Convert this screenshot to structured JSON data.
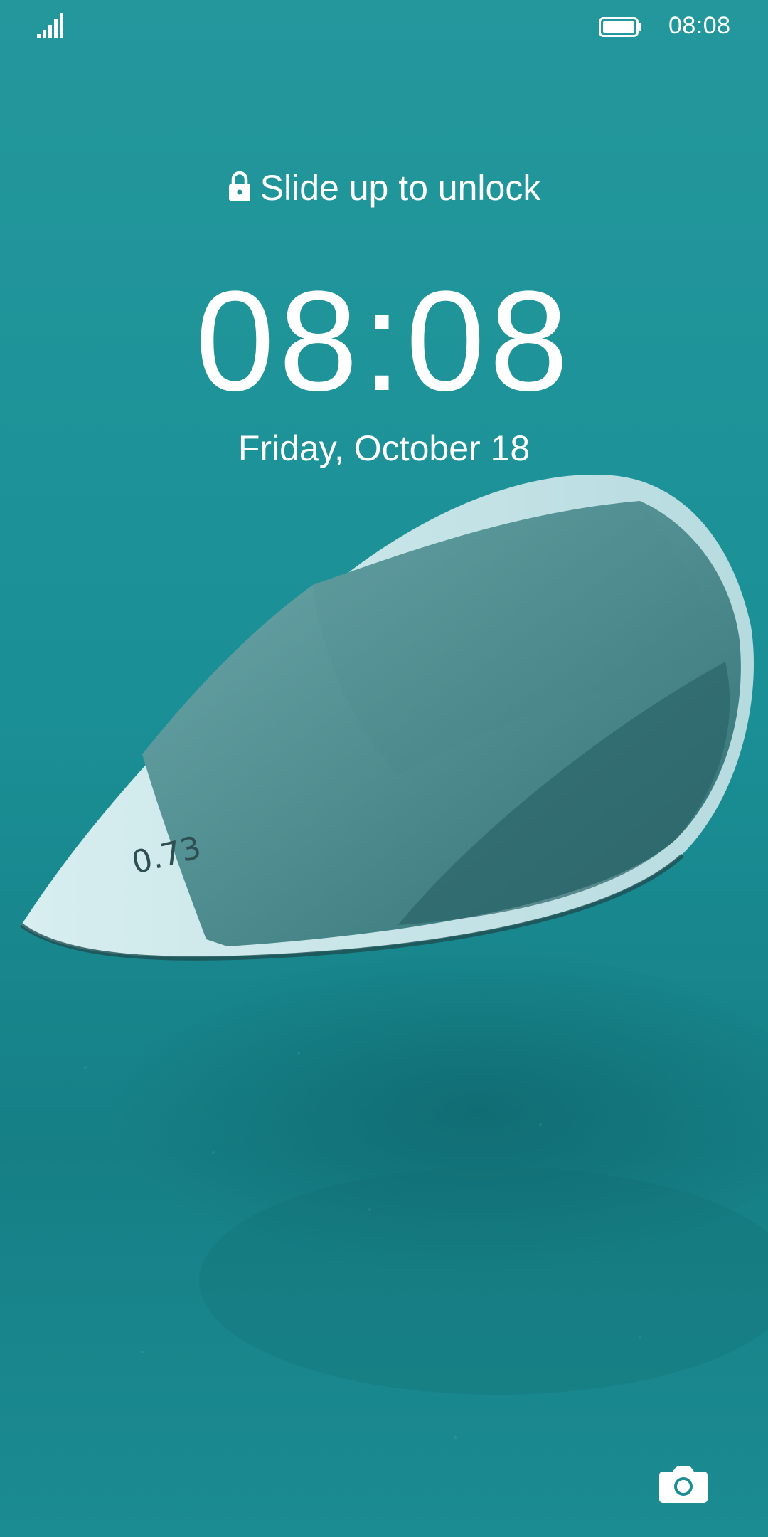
{
  "status_bar": {
    "time": "08:08",
    "signal_icon": "signal-bars-icon",
    "battery_icon": "battery-full-icon"
  },
  "lock_screen": {
    "unlock_hint": "Slide up to unlock",
    "lock_icon": "lock-icon",
    "clock": "08:08",
    "date": "Friday, October 18",
    "camera_icon": "camera-icon"
  },
  "wallpaper": {
    "pick_engraving": "0.73",
    "colors": {
      "background": "#1c8e93",
      "pick_body": "#5f9ea0",
      "pick_edge": "#cfe9ec"
    }
  }
}
